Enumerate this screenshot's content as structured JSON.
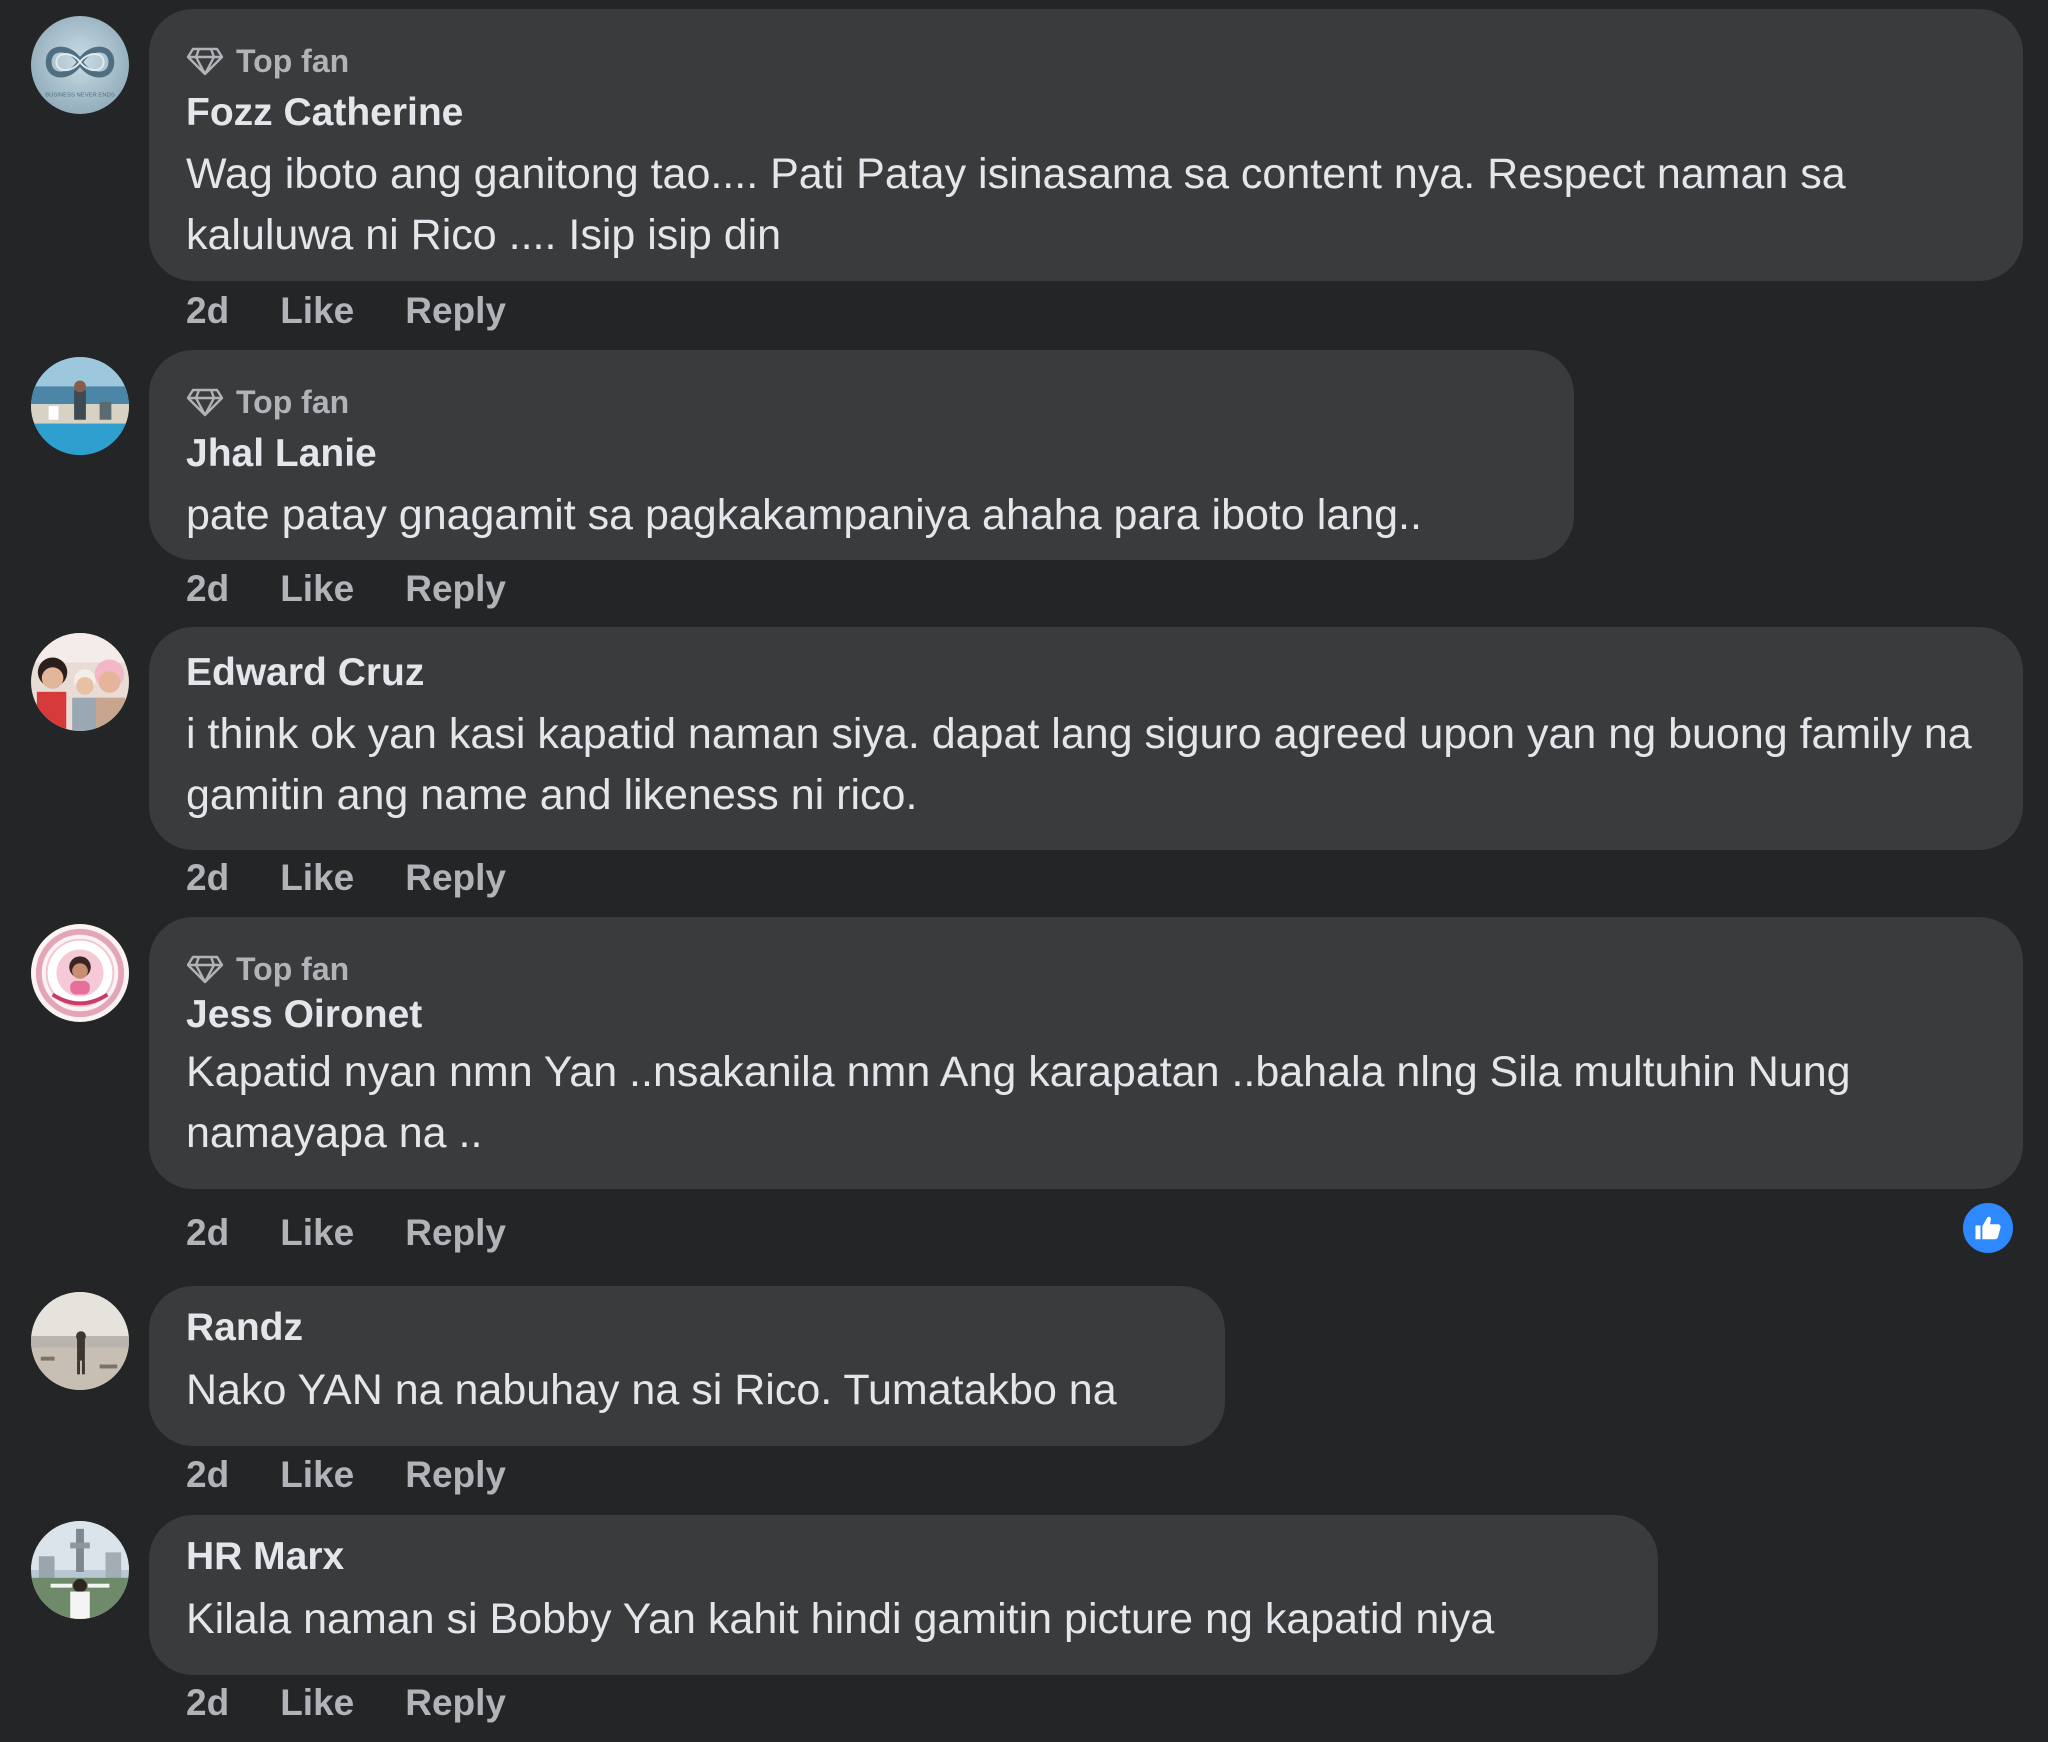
{
  "comments": [
    {
      "badge": "Top fan",
      "author": "Fozz Catherine",
      "text": "Wag iboto ang ganitong tao.... Pati Patay isinasama sa content nya. Respect naman sa kaluluwa ni Rico .... Isip isip din",
      "time": "2d",
      "like_label": "Like",
      "reply_label": "Reply",
      "avatar_icon": "infinity-logo-avatar",
      "avatar_text": "BUSINESS NEVER ENDS"
    },
    {
      "badge": "Top fan",
      "author": "Jhal Lanie",
      "text": "pate patay gnagamit sa pagkakampaniya ahaha para iboto lang..",
      "time": "2d",
      "like_label": "Like",
      "reply_label": "Reply",
      "avatar_icon": "pool-photo-avatar"
    },
    {
      "author": "Edward Cruz",
      "text": "i think ok yan kasi kapatid naman siya. dapat lang siguro agreed upon yan ng buong family na gamitin ang name and likeness ni rico.",
      "time": "2d",
      "like_label": "Like",
      "reply_label": "Reply",
      "avatar_icon": "group-selfie-avatar"
    },
    {
      "badge": "Top fan",
      "author": "Jess Oironet",
      "text": "Kapatid nyan nmn Yan ..nsakanila nmn Ang karapatan ..bahala nlng Sila multuhin Nung namayapa na ..",
      "time": "2d",
      "like_label": "Like",
      "reply_label": "Reply",
      "avatar_icon": "badge-frame-portrait-avatar",
      "reaction_icon": "like-thumb-icon",
      "reaction_color": "#2e89ff"
    },
    {
      "author": "Randz",
      "text": "Nako YAN na nabuhay na si Rico. Tumatakbo na",
      "time": "2d",
      "like_label": "Like",
      "reply_label": "Reply",
      "avatar_icon": "beach-figure-avatar"
    },
    {
      "author": "HR Marx",
      "text": "Kilala naman si Bobby Yan kahit hindi gamitin picture ng kapatid niya",
      "time": "2d",
      "like_label": "Like",
      "reply_label": "Reply",
      "avatar_icon": "city-tower-avatar"
    }
  ],
  "colors": {
    "background": "#242526",
    "bubble": "#3a3b3c",
    "primary_text": "#e4e6eb",
    "secondary_text": "#b0b3b8",
    "accent": "#2e89ff"
  }
}
